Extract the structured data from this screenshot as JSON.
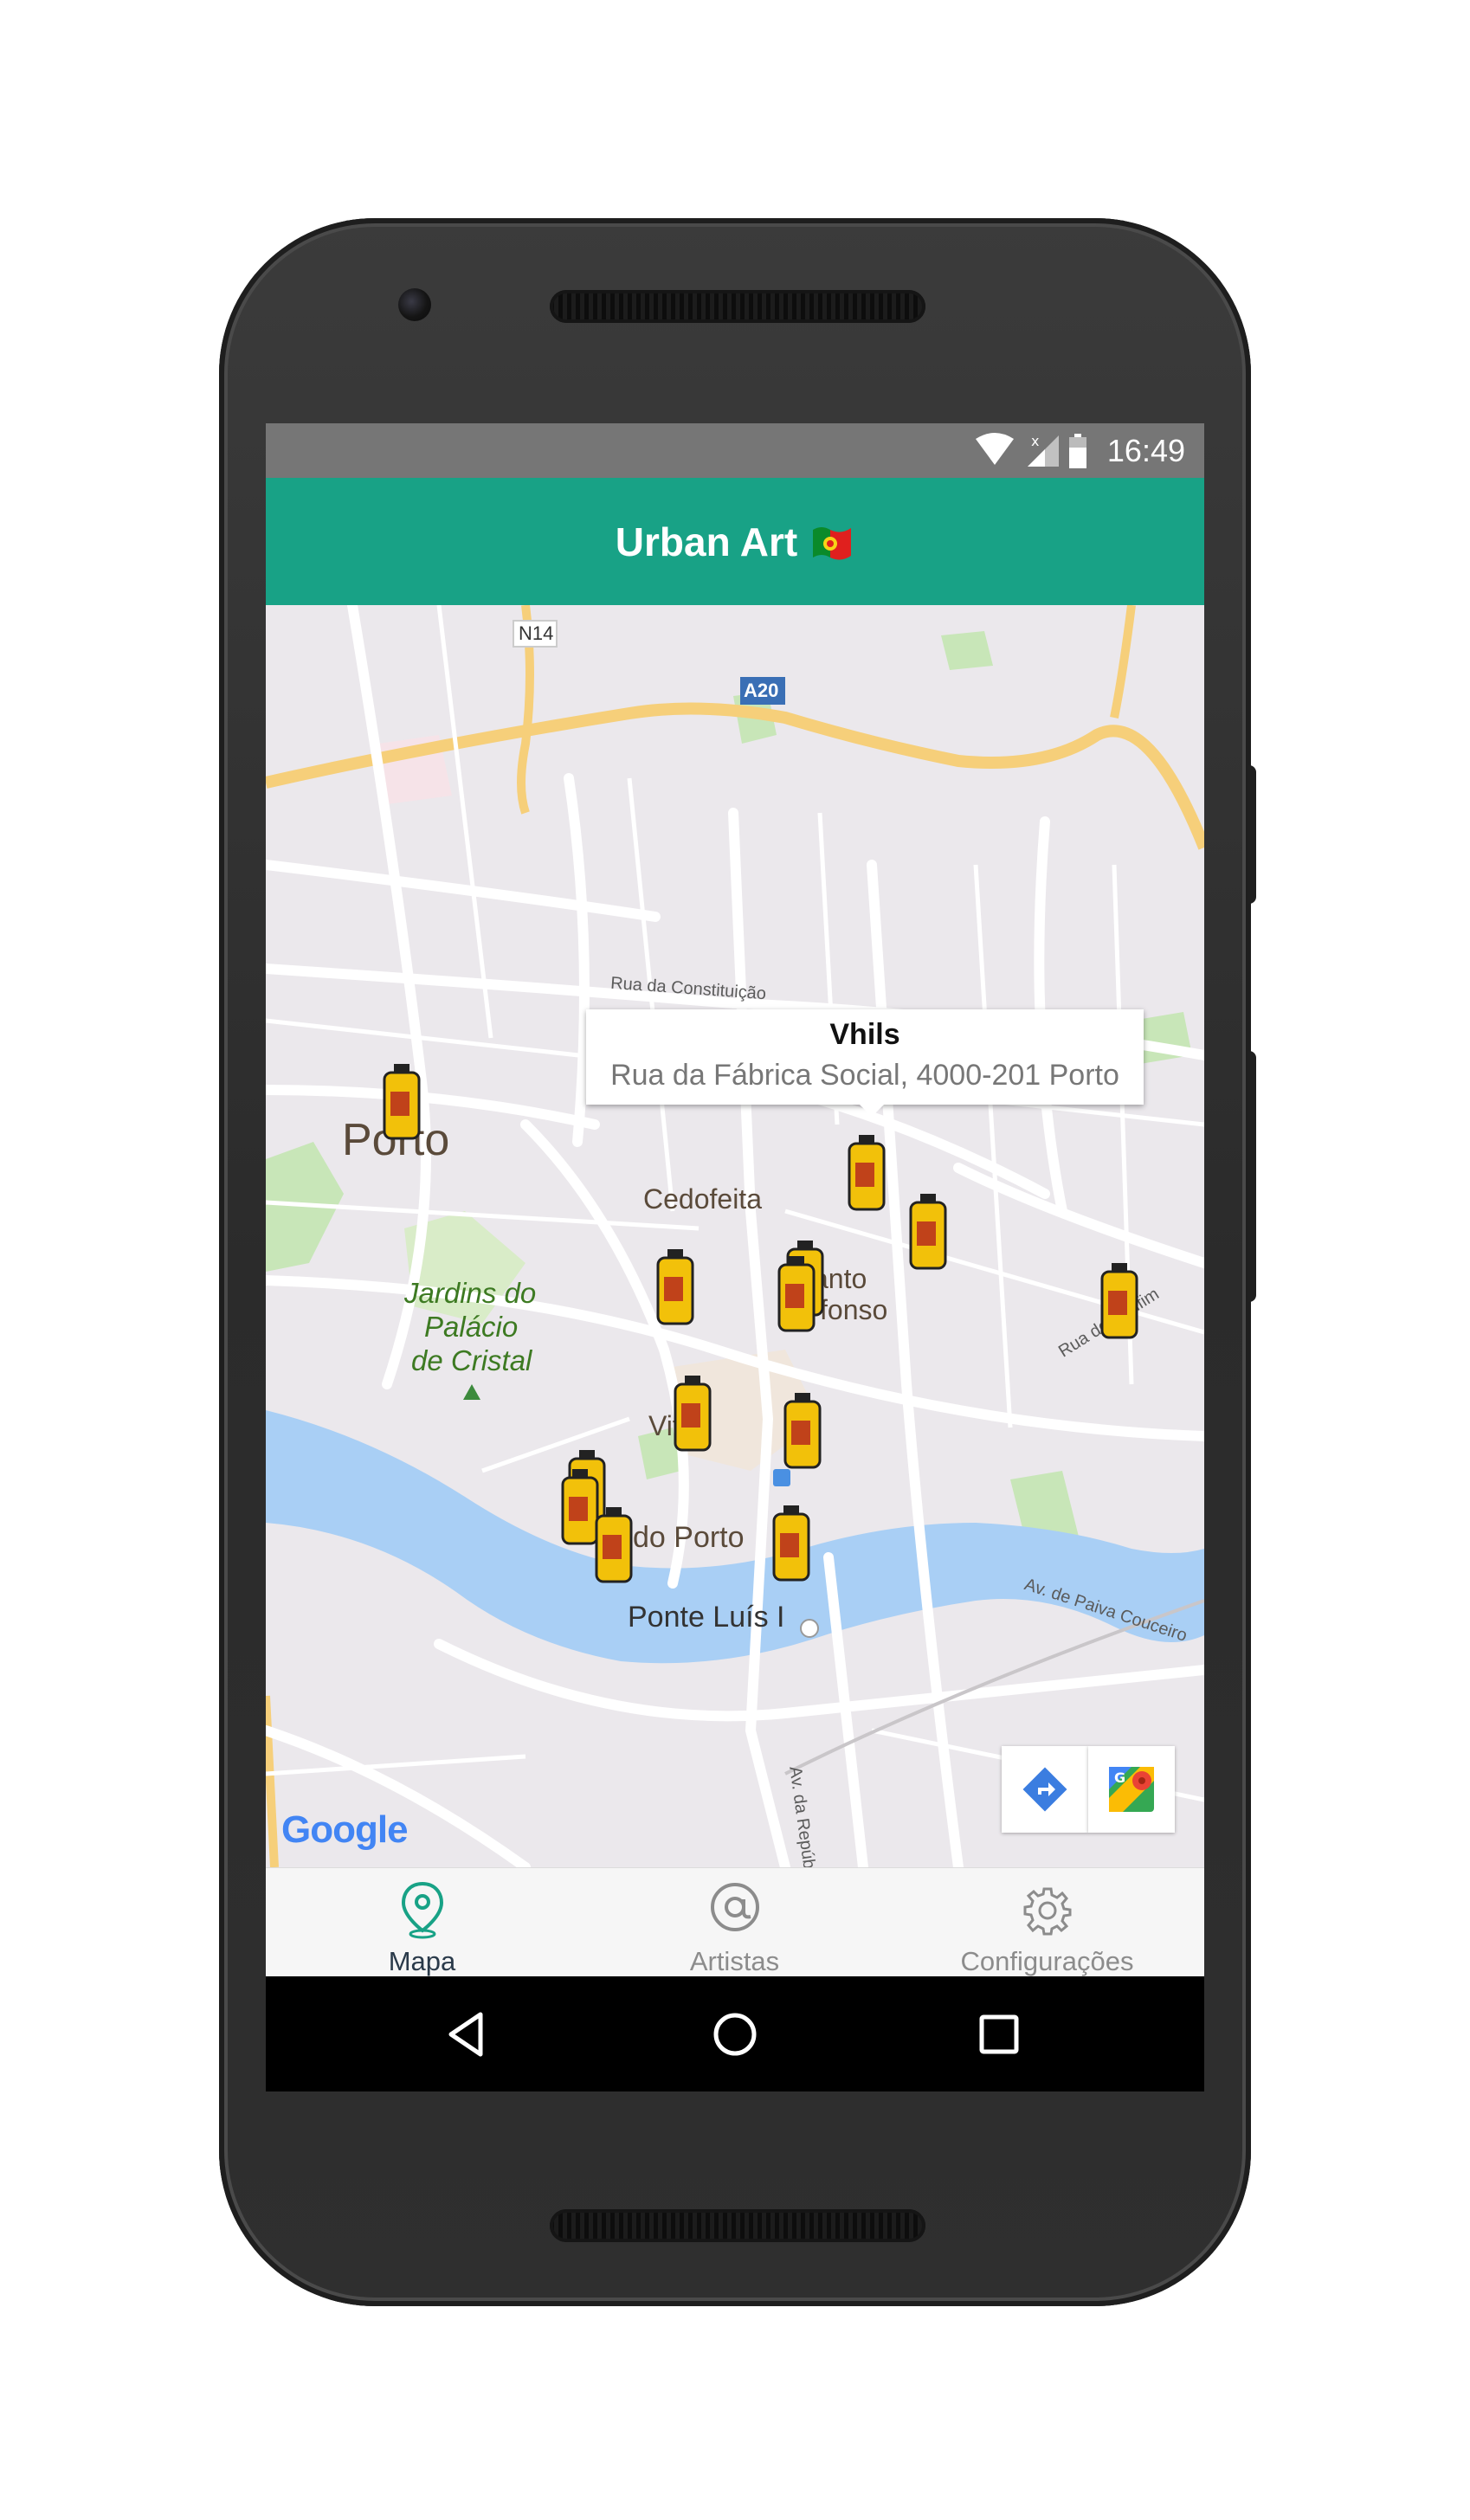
{
  "status_bar": {
    "time": "16:49"
  },
  "app_bar": {
    "title": "Urban Art"
  },
  "map": {
    "road_labels": [
      "N14",
      "A20"
    ],
    "place_labels": {
      "porto": "Porto",
      "cedofeita": "Cedofeita",
      "santo_ildefonso_a": "anto",
      "santo_ildefonso_b": "fonso",
      "jardins": [
        "Jardins do",
        "Palácio",
        "de Cristal"
      ],
      "vitoria": "Vit   a",
      "sao_porto": "do Porto",
      "ponte": "Ponte Luís I",
      "rua_constituicao": "Rua da Constituição",
      "rua_bonfim": "Rua do Bonfim",
      "av_paiva": "Av. de Paiva Couceiro",
      "av_republica": "Av. da República"
    },
    "info_window": {
      "title": "Vhils",
      "address": "Rua da Fábrica Social, 4000-201 Porto"
    },
    "google_logo": "Google",
    "colors": {
      "water": "#a9cff5",
      "park": "#c8e6b8",
      "highway": "#f6cf7a",
      "road": "#ffffff",
      "background": "#ebe8ec"
    }
  },
  "tabs": [
    {
      "label": "Mapa",
      "icon": "location-pin-icon",
      "active": true
    },
    {
      "label": "Artistas",
      "icon": "at-sign-icon",
      "active": false
    },
    {
      "label": "Configurações",
      "icon": "gear-icon",
      "active": false
    }
  ],
  "nav_bar": {
    "buttons": [
      "back-icon",
      "home-icon",
      "recents-icon"
    ]
  },
  "accent_color": "#18a286"
}
